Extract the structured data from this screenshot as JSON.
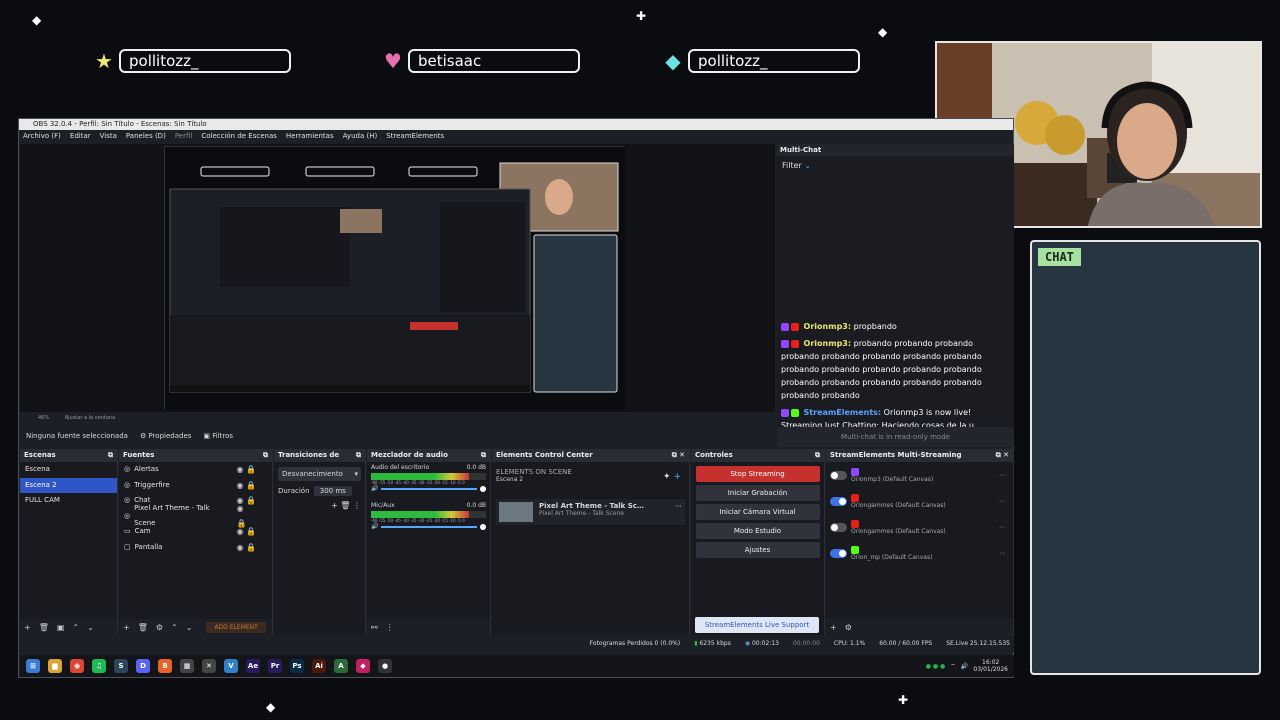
{
  "overlay": {
    "names": [
      {
        "icon": "star-icon",
        "color": "#e8e870",
        "name": "pollitozz_"
      },
      {
        "icon": "heart-icon",
        "color": "#e66fb0",
        "name": "betisaac"
      },
      {
        "icon": "diamond-icon",
        "color": "#6fe0e0",
        "name": "pollitozz_"
      }
    ],
    "chat_label": "CHAT"
  },
  "obs": {
    "window_title": "OBS 32.0.4 - Perfil: Sin Título - Escenas: Sin Título",
    "menu": [
      "Archivo (F)",
      "Editar",
      "Vista",
      "Paneles (D)",
      "Perfil",
      "Colección de Escenas",
      "Herramientas",
      "Ayuda (H)",
      "StreamElements"
    ],
    "zoom": "46%",
    "fit_label": "Ajustar a la ventana",
    "source_bar": {
      "no_source": "Ninguna fuente seleccionada",
      "properties": "Propiedades",
      "filters": "Filtros"
    },
    "multichat": {
      "title": "Multi-Chat",
      "filter": "Filter",
      "messages": [
        {
          "user": "Orionmp3:",
          "user_color": "#e8e870",
          "text": "propbando"
        },
        {
          "user": "Orionmp3:",
          "user_color": "#e8e870",
          "text": "probando probando probando probando probando probando probando probando probando probando probando probando probando probando probando probando probando probando probando probando"
        },
        {
          "user": "StreamElements:",
          "user_color": "#5aa3ff",
          "text": "Orionmp3 is now live! Streaming Just Chatting: Haciendo cosas de la u"
        }
      ],
      "footer": "Multi-chat is in read-only mode"
    },
    "scenes": {
      "title": "Escenas",
      "items": [
        "Escena",
        "Escena 2",
        "FULL CAM"
      ],
      "selected": 1
    },
    "sources": {
      "title": "Fuentes",
      "items": [
        "Alertas",
        "Triggerfire",
        "Chat",
        "Pixel Art Theme - Talk Scene",
        "Cam",
        "Pantalla"
      ],
      "add_element": "ADD ELEMENT"
    },
    "transitions": {
      "title": "Transiciones de esc…",
      "type": "Desvanecimiento",
      "duration_label": "Duración",
      "duration": "300 ms"
    },
    "mixer": {
      "title": "Mezclador de audio",
      "channels": [
        {
          "name": "Audio del escritorio",
          "db": "0.0 dB",
          "scale": "-60 -55 -50 -45 -40 -35 -30 -25 -20 -15 -10 -5 0"
        },
        {
          "name": "Mic/Aux",
          "db": "0.0 dB",
          "scale": "-60 -55 -50 -45 -40 -35 -30 -25 -20 -15 -10 -5 0"
        }
      ]
    },
    "ecc": {
      "title": "Elements Control Center",
      "on_scene": "ELEMENTS ON SCENE",
      "scene": "Escena 2",
      "item_title": "Pixel Art Theme - Talk Sc…",
      "item_sub": "Pixel Art Theme - Talk Scene"
    },
    "controls": {
      "title": "Controles",
      "stop": "Stop Streaming",
      "record": "Iniciar Grabación",
      "virtual_cam": "Iniciar Cámara Virtual",
      "studio": "Modo Estudio",
      "settings": "Ajustes",
      "support": "StreamElements Live Support"
    },
    "multistream": {
      "title": "StreamElements Multi-Streaming",
      "outputs": [
        {
          "name": "Orionmp3 (Default Canvas)",
          "on": false,
          "platform_color": "#9146ff"
        },
        {
          "name": "Oriongammes (Default Canvas)",
          "on": true,
          "platform_color": "#e62117"
        },
        {
          "name": "Oriongammes (Default Canvas)",
          "on": false,
          "platform_color": "#e62117"
        },
        {
          "name": "Orion_mp (Default Canvas)",
          "on": true,
          "platform_color": "#53fc18"
        }
      ]
    },
    "status": {
      "dropped": "Fotogramas Perdidos 0 (0.0%)",
      "kbps": "6235 kbps",
      "live_time": "00:02:13",
      "rec_time": "00:00:00",
      "cpu": "CPU: 1.1%",
      "fps": "60.00 / 60.00 FPS",
      "version": "SE.Live 25.12.15.535"
    },
    "taskbar": {
      "apps": [
        {
          "name": "windows-start-icon",
          "label": "⊞",
          "color": "#3a7bd5"
        },
        {
          "name": "file-explorer-icon",
          "label": "▆",
          "color": "#d9a53a"
        },
        {
          "name": "chrome-icon",
          "label": "◉",
          "color": "#db4437"
        },
        {
          "name": "spotify-icon",
          "label": "♫",
          "color": "#1db954"
        },
        {
          "name": "steam-icon",
          "label": "S",
          "color": "#2a475e"
        },
        {
          "name": "discord-icon",
          "label": "D",
          "color": "#5865f2"
        },
        {
          "name": "brave-icon",
          "label": "B",
          "color": "#e8622a"
        },
        {
          "name": "game-icon",
          "label": "▦",
          "color": "#444"
        },
        {
          "name": "tool-icon",
          "label": "✕",
          "color": "#444"
        },
        {
          "name": "vscode-icon",
          "label": "V",
          "color": "#2f80c9"
        },
        {
          "name": "after-effects-icon",
          "label": "Ae",
          "color": "#2a1a5e"
        },
        {
          "name": "premiere-icon",
          "label": "Pr",
          "color": "#2a1a5e"
        },
        {
          "name": "photoshop-icon",
          "label": "Ps",
          "color": "#0a2a4a"
        },
        {
          "name": "illustrator-icon",
          "label": "Ai",
          "color": "#4a1a0a"
        },
        {
          "name": "app-icon",
          "label": "A",
          "color": "#2d6a3a"
        },
        {
          "name": "streamelements-icon",
          "label": "◆",
          "color": "#c02060"
        },
        {
          "name": "obs-icon",
          "label": "●",
          "color": "#333"
        }
      ],
      "time": "16:02",
      "date": "03/01/2026"
    }
  }
}
